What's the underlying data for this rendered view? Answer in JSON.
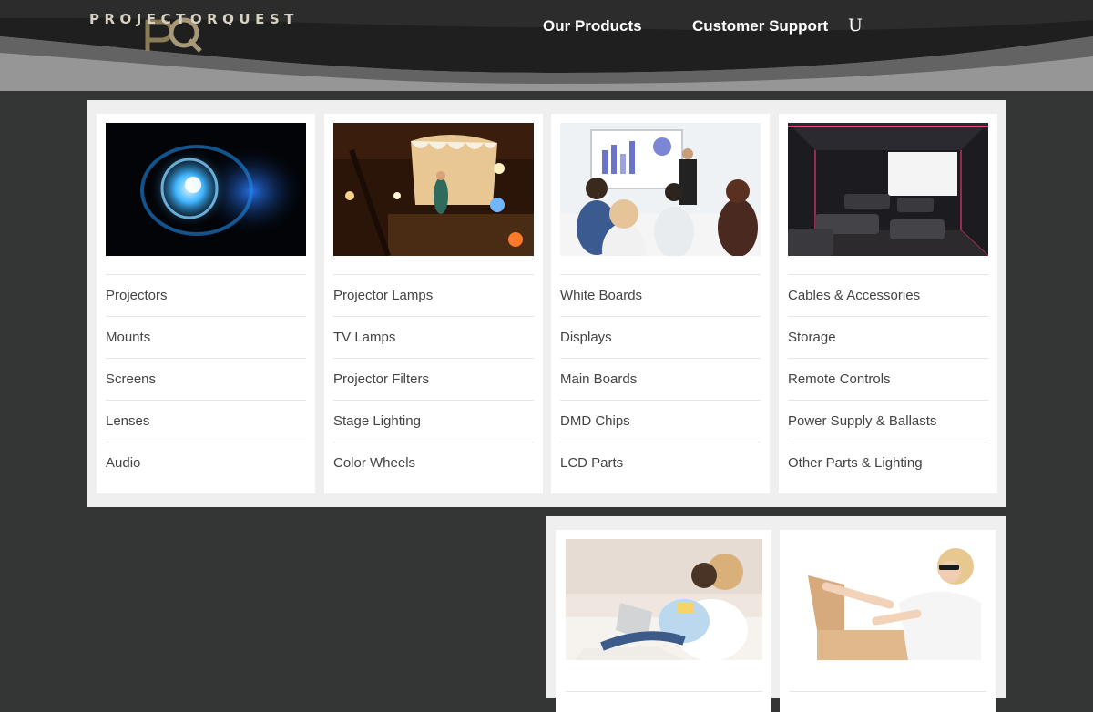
{
  "header": {
    "logo_text": "PROJECTORQUEST",
    "nav": {
      "products": "Our Products",
      "support": "Customer Support",
      "user_glyph": "U"
    }
  },
  "menu": {
    "columns": [
      {
        "image": "projector-lens-image",
        "links": [
          "Projectors",
          "Mounts",
          "Screens",
          "Lenses",
          "Audio"
        ]
      },
      {
        "image": "theater-stage-image",
        "links": [
          "Projector Lamps",
          "TV Lamps",
          "Projector Filters",
          "Stage Lighting",
          "Color Wheels"
        ]
      },
      {
        "image": "classroom-presentation-image",
        "links": [
          "White Boards",
          "Displays",
          "Main Boards",
          "DMD Chips",
          "LCD Parts"
        ]
      },
      {
        "image": "home-theater-image",
        "links": [
          "Cables & Accessories",
          "Storage",
          "Remote Controls",
          "Power Supply & Ballasts",
          "Other Parts & Lighting"
        ]
      }
    ]
  },
  "promos": {
    "cards": [
      {
        "image": "couple-shopping-online-image"
      },
      {
        "image": "woman-opening-box-image"
      }
    ]
  },
  "colors": {
    "page_background": "#343636",
    "header_dark": "#1f1f1f",
    "header_band": "#969696",
    "panel_background": "#efefef",
    "link_text": "#444444"
  }
}
